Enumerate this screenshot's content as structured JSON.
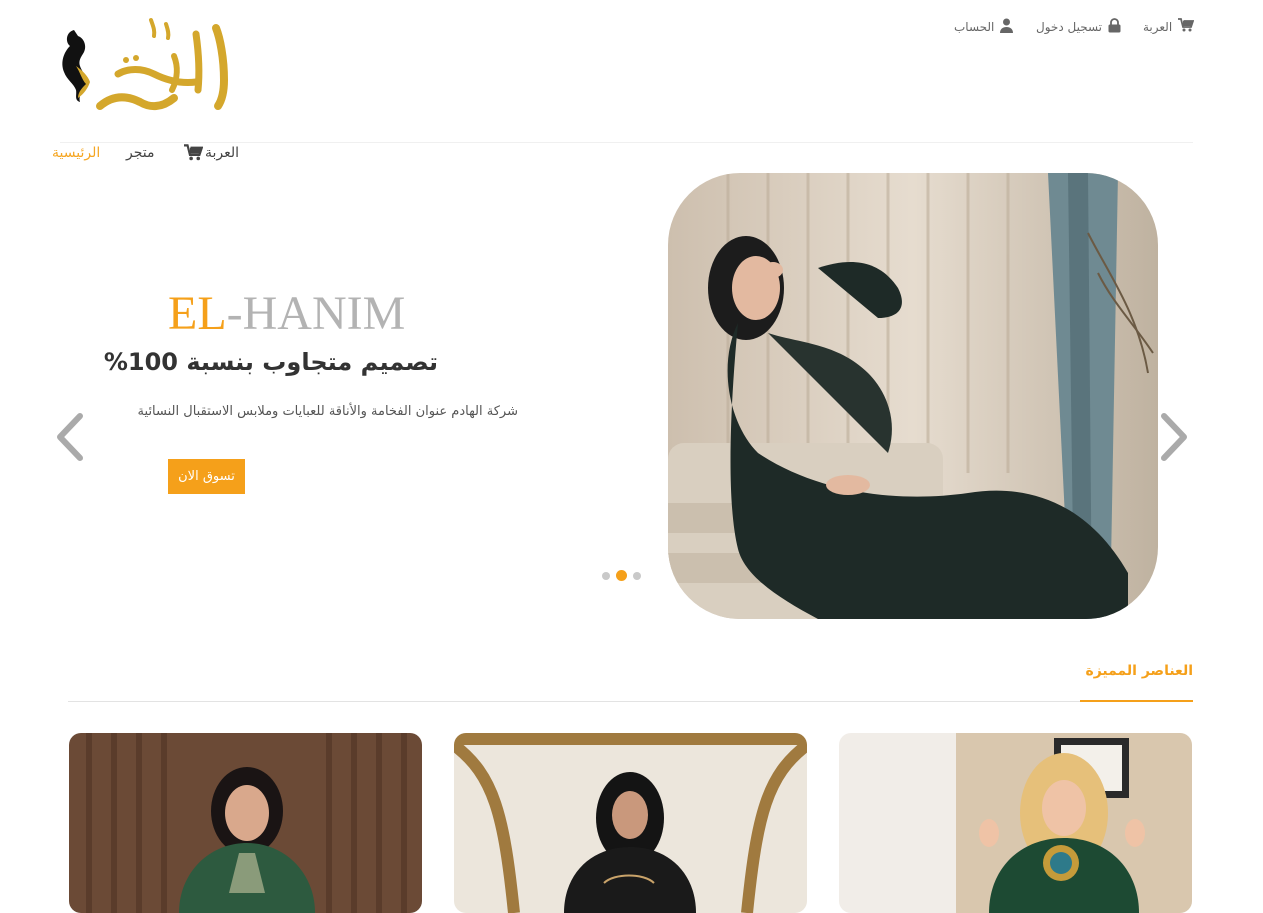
{
  "topbar": {
    "cart_label": "العربة",
    "login_label": "تسجيل دخول",
    "account_label": "الحساب"
  },
  "nav": {
    "home_label": "الرئيسية",
    "shop_label": "متجر",
    "cart_label": "العربة"
  },
  "hero": {
    "brand_part1": "EL",
    "brand_part2": "-HANIM",
    "heading": "تصميم متجاوب بنسبة 100%",
    "subtitle": "شركة الهادم عنوان الفخامة والأناقة للعبايات وملابس الاستقبال النسائية",
    "cta_label": "تسوق الان",
    "slide_count": 3,
    "active_slide": 2
  },
  "featured": {
    "title": "العناصر المميزة"
  },
  "colors": {
    "accent": "#f5a01a",
    "logo_gold": "#d4a72c"
  },
  "icons": [
    "cart-icon",
    "lock-icon",
    "user-icon",
    "chevron-left-icon",
    "chevron-right-icon"
  ]
}
